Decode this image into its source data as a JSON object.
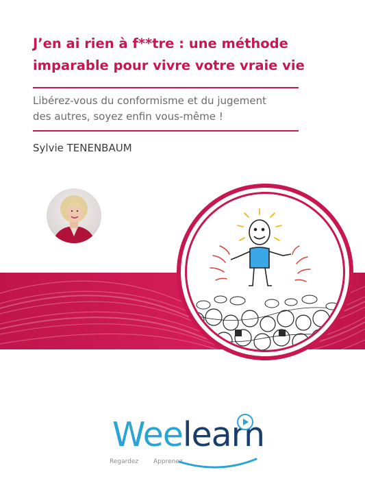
{
  "cover": {
    "title_line1": "J’en ai rien à f**tre : une méthode",
    "title_line2": "imparable pour vivre votre vraie vie",
    "subtitle_line1": "Libérez-vous du conformisme et du jugement",
    "subtitle_line2": "des autres, soyez enfin vous-même !",
    "author": "Sylvie TENENBAUM"
  },
  "logo": {
    "wee": "Wee",
    "learn": "learn",
    "tagline_left": "Regardez",
    "tagline_right": "Apprenez"
  },
  "colors": {
    "accent": "#c8174f",
    "logo_blue": "#2aa3d5",
    "logo_navy": "#1a3e6b"
  }
}
